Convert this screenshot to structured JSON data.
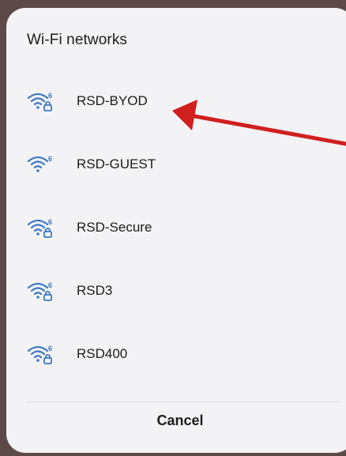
{
  "dialog": {
    "title": "Wi-Fi networks",
    "cancel_label": "Cancel"
  },
  "networks": [
    {
      "name": "RSD-BYOD",
      "icon": "wifi-6-secured-icon",
      "secured": true
    },
    {
      "name": "RSD-GUEST",
      "icon": "wifi-6-icon",
      "secured": false
    },
    {
      "name": "RSD-Secure",
      "icon": "wifi-6-secured-icon",
      "secured": true
    },
    {
      "name": "RSD3",
      "icon": "wifi-6-secured-icon",
      "secured": true
    },
    {
      "name": "RSD400",
      "icon": "wifi-6-secured-icon",
      "secured": true
    }
  ],
  "colors": {
    "icon": "#3e78c4",
    "arrow": "#d01f1f",
    "dialog_bg": "#f3f3f5"
  }
}
